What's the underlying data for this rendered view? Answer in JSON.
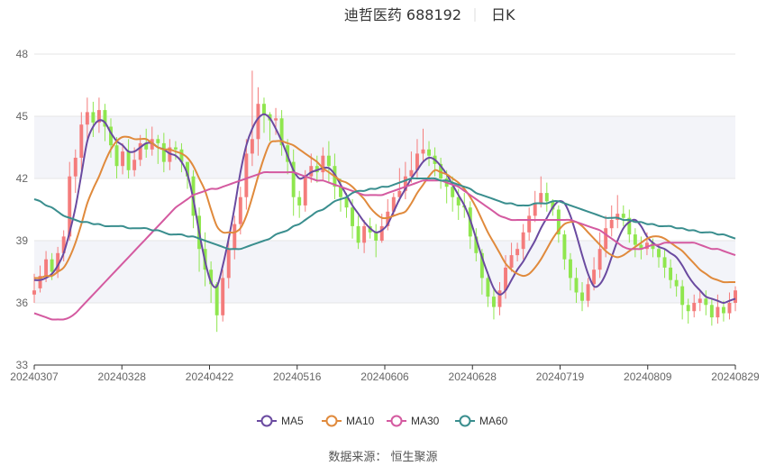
{
  "header": {
    "title": "迪哲医药 688192",
    "period": "日K"
  },
  "source": "数据来源： 恒生聚源",
  "chart_data": {
    "type": "candlestick",
    "ylim": [
      33,
      48
    ],
    "yticks": [
      33,
      36,
      39,
      42,
      45,
      48
    ],
    "xticks": [
      "20240307",
      "20240328",
      "20240422",
      "20240516",
      "20240606",
      "20240628",
      "20240719",
      "20240809",
      "20240829"
    ],
    "num_days": 120,
    "colors": {
      "up": "#f47c7c",
      "down": "#8fe64e",
      "MA5": "#6a4aa0",
      "MA10": "#e08a3c",
      "MA30": "#d45aa0",
      "MA60": "#3a8e8e"
    },
    "candles": [
      [
        36.4,
        36.6,
        36.0,
        37.4
      ],
      [
        36.7,
        37.3,
        36.5,
        37.8
      ],
      [
        37.3,
        38.1,
        37.0,
        38.5
      ],
      [
        38.1,
        37.5,
        37.1,
        38.4
      ],
      [
        37.5,
        38.4,
        37.2,
        38.7
      ],
      [
        38.4,
        39.2,
        38.0,
        39.5
      ],
      [
        39.2,
        42.1,
        39.0,
        42.8
      ],
      [
        42.1,
        43.0,
        41.3,
        43.4
      ],
      [
        43.0,
        44.6,
        42.4,
        45.2
      ],
      [
        44.6,
        45.2,
        43.9,
        45.9
      ],
      [
        45.2,
        44.7,
        44.0,
        45.7
      ],
      [
        44.7,
        45.3,
        44.2,
        45.9
      ],
      [
        45.3,
        44.5,
        43.8,
        45.6
      ],
      [
        44.5,
        43.6,
        43.0,
        44.9
      ],
      [
        43.6,
        42.6,
        42.0,
        44.0
      ],
      [
        42.6,
        43.3,
        42.2,
        43.7
      ],
      [
        43.3,
        42.4,
        42.0,
        43.9
      ],
      [
        42.4,
        42.9,
        42.1,
        43.5
      ],
      [
        42.9,
        43.7,
        42.6,
        44.1
      ],
      [
        43.7,
        43.4,
        43.0,
        44.4
      ],
      [
        43.4,
        43.9,
        43.1,
        44.5
      ],
      [
        43.9,
        43.7,
        42.7,
        44.1
      ],
      [
        43.7,
        42.8,
        42.3,
        44.2
      ],
      [
        42.8,
        43.5,
        42.4,
        43.9
      ],
      [
        43.5,
        43.4,
        42.9,
        43.8
      ],
      [
        43.4,
        42.8,
        42.3,
        43.7
      ],
      [
        42.8,
        42.1,
        41.5,
        42.6
      ],
      [
        42.1,
        40.2,
        39.6,
        42.4
      ],
      [
        40.2,
        38.6,
        37.5,
        40.6
      ],
      [
        38.6,
        37.6,
        36.8,
        39.4
      ],
      [
        37.6,
        36.9,
        36.0,
        38.0
      ],
      [
        36.9,
        35.4,
        34.6,
        37.0
      ],
      [
        35.4,
        37.2,
        35.1,
        37.6
      ],
      [
        37.2,
        38.6,
        36.7,
        39.0
      ],
      [
        38.6,
        39.8,
        38.1,
        40.2
      ],
      [
        39.8,
        41.1,
        39.3,
        41.6
      ],
      [
        41.1,
        43.2,
        40.5,
        43.9
      ],
      [
        43.2,
        43.9,
        42.6,
        47.2
      ],
      [
        43.9,
        45.6,
        43.1,
        46.4
      ],
      [
        45.6,
        45.1,
        44.2,
        45.9
      ],
      [
        45.1,
        44.8,
        43.8,
        45.2
      ],
      [
        44.8,
        44.9,
        44.1,
        45.4
      ],
      [
        44.9,
        43.6,
        43.1,
        45.3
      ],
      [
        43.6,
        42.8,
        42.2,
        43.9
      ],
      [
        42.8,
        41.1,
        40.2,
        43.4
      ],
      [
        41.1,
        40.7,
        40.1,
        41.4
      ],
      [
        40.7,
        42.1,
        40.4,
        42.4
      ],
      [
        42.1,
        42.6,
        41.8,
        43.2
      ],
      [
        42.6,
        42.3,
        41.8,
        43.1
      ],
      [
        42.3,
        43.1,
        41.9,
        43.5
      ],
      [
        43.1,
        42.6,
        41.8,
        43.8
      ],
      [
        42.6,
        41.6,
        41.0,
        43.2
      ],
      [
        41.6,
        41.1,
        40.4,
        42.0
      ],
      [
        41.1,
        40.6,
        40.1,
        41.3
      ],
      [
        40.6,
        39.7,
        39.1,
        41.0
      ],
      [
        39.7,
        38.9,
        38.6,
        40.2
      ],
      [
        38.9,
        39.7,
        38.4,
        40.0
      ],
      [
        39.7,
        39.4,
        39.1,
        40.1
      ],
      [
        39.4,
        39.0,
        38.2,
        39.8
      ],
      [
        39.0,
        39.7,
        38.9,
        40.3
      ],
      [
        39.7,
        40.4,
        39.5,
        41.0
      ],
      [
        40.4,
        41.1,
        40.2,
        41.3
      ],
      [
        41.1,
        41.4,
        40.9,
        42.5
      ],
      [
        41.4,
        42.1,
        41.0,
        42.8
      ],
      [
        42.1,
        42.4,
        41.8,
        43.3
      ],
      [
        42.4,
        43.2,
        42.0,
        43.9
      ],
      [
        43.2,
        43.4,
        42.8,
        44.4
      ],
      [
        43.4,
        43.1,
        42.6,
        43.8
      ],
      [
        43.1,
        42.7,
        42.1,
        43.5
      ],
      [
        42.7,
        42.0,
        41.5,
        43.0
      ],
      [
        42.0,
        41.6,
        40.8,
        42.4
      ],
      [
        41.6,
        41.1,
        40.4,
        42.1
      ],
      [
        41.1,
        40.7,
        40.0,
        41.5
      ],
      [
        40.7,
        40.6,
        40.1,
        41.3
      ],
      [
        40.6,
        39.2,
        38.6,
        40.9
      ],
      [
        39.2,
        38.4,
        38.0,
        39.6
      ],
      [
        38.4,
        37.2,
        36.4,
        38.6
      ],
      [
        37.2,
        36.3,
        35.8,
        37.5
      ],
      [
        36.3,
        35.8,
        35.2,
        36.7
      ],
      [
        35.8,
        36.6,
        35.4,
        37.0
      ],
      [
        36.6,
        37.7,
        36.2,
        38.3
      ],
      [
        37.7,
        38.3,
        37.5,
        38.9
      ],
      [
        38.3,
        38.6,
        38.0,
        38.9
      ],
      [
        38.6,
        39.4,
        38.1,
        39.8
      ],
      [
        39.4,
        40.2,
        39.0,
        40.6
      ],
      [
        40.2,
        40.8,
        39.9,
        41.4
      ],
      [
        40.8,
        41.3,
        40.6,
        42.1
      ],
      [
        41.3,
        40.9,
        40.4,
        41.8
      ],
      [
        40.9,
        40.5,
        40.2,
        41.0
      ],
      [
        40.5,
        39.3,
        38.9,
        40.7
      ],
      [
        39.3,
        38.1,
        37.6,
        39.5
      ],
      [
        38.1,
        37.2,
        36.6,
        38.4
      ],
      [
        37.2,
        36.5,
        36.0,
        37.7
      ],
      [
        36.5,
        36.1,
        35.6,
        37.0
      ],
      [
        36.1,
        36.9,
        35.8,
        37.2
      ],
      [
        36.9,
        37.6,
        36.6,
        38.2
      ],
      [
        37.6,
        38.6,
        37.2,
        39.4
      ],
      [
        38.6,
        39.6,
        38.2,
        40.2
      ],
      [
        39.6,
        40.0,
        39.2,
        40.7
      ],
      [
        40.0,
        40.3,
        39.6,
        41.2
      ],
      [
        40.3,
        40.1,
        39.7,
        40.7
      ],
      [
        40.1,
        39.3,
        38.9,
        40.5
      ],
      [
        39.3,
        38.8,
        38.2,
        39.6
      ],
      [
        38.8,
        38.6,
        38.1,
        39.2
      ],
      [
        38.6,
        38.9,
        38.3,
        39.4
      ],
      [
        38.9,
        38.6,
        38.2,
        39.1
      ],
      [
        38.6,
        38.2,
        37.7,
        38.8
      ],
      [
        38.2,
        37.7,
        37.2,
        38.6
      ],
      [
        37.7,
        37.1,
        36.7,
        38.1
      ],
      [
        37.1,
        36.8,
        36.3,
        37.4
      ],
      [
        36.8,
        35.9,
        35.2,
        37.1
      ],
      [
        35.9,
        35.6,
        35.0,
        36.2
      ],
      [
        35.6,
        36.0,
        35.3,
        36.4
      ],
      [
        36.0,
        36.2,
        35.6,
        36.6
      ],
      [
        36.2,
        35.9,
        35.4,
        36.6
      ],
      [
        35.9,
        35.3,
        34.9,
        36.2
      ],
      [
        35.3,
        35.8,
        35.0,
        36.4
      ],
      [
        35.8,
        35.5,
        35.1,
        36.1
      ],
      [
        35.5,
        36.0,
        35.2,
        36.5
      ],
      [
        36.0,
        36.6,
        35.6,
        36.8
      ]
    ],
    "series": [
      {
        "name": "MA5",
        "values": [
          37.1,
          37.1,
          37.2,
          37.4,
          37.8,
          38.4,
          39.4,
          40.6,
          42.2,
          43.8,
          44.5,
          44.8,
          44.7,
          44.2,
          43.8,
          43.6,
          43.3,
          43.3,
          43.5,
          43.7,
          43.7,
          43.5,
          43.4,
          43.2,
          43.1,
          42.8,
          42.2,
          41.0,
          39.4,
          38.0,
          37.0,
          36.8,
          37.8,
          39.1,
          40.6,
          42.3,
          43.6,
          44.4,
          44.9,
          45.1,
          44.9,
          44.4,
          43.8,
          43.1,
          42.4,
          42.0,
          42.1,
          42.3,
          42.4,
          42.5,
          42.5,
          42.2,
          41.7,
          41.2,
          40.7,
          40.3,
          39.9,
          39.6,
          39.4,
          39.5,
          39.8,
          40.4,
          41.0,
          41.5,
          42.0,
          42.4,
          42.8,
          43.0,
          42.9,
          42.6,
          42.2,
          41.7,
          41.2,
          40.7,
          40.0,
          39.1,
          38.2,
          37.4,
          36.7,
          36.4,
          36.6,
          37.1,
          37.6,
          38.0,
          38.5,
          39.0,
          39.6,
          40.1,
          40.6,
          40.9,
          40.8,
          40.2,
          39.3,
          38.3,
          37.4,
          36.8,
          36.9,
          37.4,
          38.2,
          39.0,
          39.6,
          39.9,
          40.0,
          39.7,
          39.2,
          38.9,
          38.7,
          38.6,
          38.4,
          38.2,
          37.8,
          37.3,
          36.9,
          36.6,
          36.3,
          36.2,
          36.1,
          36.0,
          36.1,
          36.2
        ]
      },
      {
        "name": "MA10",
        "values": [
          37.2,
          37.2,
          37.3,
          37.3,
          37.5,
          37.7,
          38.2,
          38.9,
          39.8,
          40.8,
          41.5,
          42.1,
          42.8,
          43.4,
          43.8,
          44.0,
          44.0,
          43.9,
          43.9,
          43.9,
          43.7,
          43.5,
          43.4,
          43.4,
          43.3,
          43.2,
          43.0,
          42.6,
          42.0,
          41.4,
          40.5,
          39.7,
          39.4,
          39.4,
          39.4,
          39.6,
          40.2,
          41.1,
          42.1,
          43.0,
          43.7,
          43.8,
          43.8,
          43.7,
          43.6,
          43.4,
          43.2,
          43.0,
          42.8,
          42.5,
          42.3,
          42.1,
          41.9,
          41.8,
          41.6,
          41.3,
          41.0,
          40.6,
          40.3,
          40.1,
          40.1,
          40.2,
          40.3,
          40.4,
          40.8,
          41.3,
          41.7,
          42.1,
          42.4,
          42.3,
          42.2,
          42.0,
          41.8,
          41.5,
          41.1,
          40.6,
          40.0,
          39.4,
          38.9,
          38.4,
          37.9,
          37.6,
          37.4,
          37.3,
          37.4,
          37.7,
          38.1,
          38.6,
          39.1,
          39.5,
          39.8,
          39.9,
          39.9,
          39.7,
          39.4,
          39.1,
          38.8,
          38.5,
          38.3,
          38.2,
          38.3,
          38.5,
          38.7,
          38.9,
          39.1,
          39.2,
          39.2,
          39.1,
          38.9,
          38.7,
          38.5,
          38.2,
          37.9,
          37.6,
          37.4,
          37.2,
          37.1,
          37.0,
          37.0,
          37.0
        ]
      },
      {
        "name": "MA30",
        "values": [
          35.5,
          35.4,
          35.3,
          35.2,
          35.2,
          35.2,
          35.3,
          35.5,
          35.8,
          36.1,
          36.4,
          36.7,
          37.0,
          37.3,
          37.6,
          37.9,
          38.2,
          38.5,
          38.8,
          39.1,
          39.4,
          39.7,
          40.0,
          40.3,
          40.6,
          40.8,
          41.0,
          41.2,
          41.3,
          41.4,
          41.5,
          41.5,
          41.6,
          41.7,
          41.8,
          41.9,
          42.0,
          42.1,
          42.2,
          42.3,
          42.3,
          42.3,
          42.3,
          42.3,
          42.3,
          42.2,
          42.1,
          42.0,
          41.9,
          41.9,
          41.8,
          41.7,
          41.6,
          41.5,
          41.4,
          41.3,
          41.2,
          41.2,
          41.2,
          41.2,
          41.3,
          41.4,
          41.5,
          41.6,
          41.7,
          41.8,
          41.9,
          41.9,
          41.9,
          41.9,
          41.8,
          41.7,
          41.6,
          41.4,
          41.2,
          41.0,
          40.8,
          40.6,
          40.4,
          40.2,
          40.1,
          40.0,
          40.0,
          40.0,
          40.0,
          40.0,
          40.0,
          40.0,
          40.0,
          40.0,
          40.0,
          40.0,
          39.9,
          39.8,
          39.7,
          39.6,
          39.5,
          39.3,
          39.1,
          38.9,
          38.7,
          38.6,
          38.6,
          38.6,
          38.7,
          38.8,
          38.8,
          38.9,
          38.9,
          38.9,
          38.9,
          38.9,
          38.9,
          38.8,
          38.7,
          38.6,
          38.6,
          38.5,
          38.4,
          38.3
        ]
      },
      {
        "name": "MA60",
        "values": [
          41.0,
          40.9,
          40.7,
          40.6,
          40.4,
          40.2,
          40.1,
          40.0,
          39.9,
          39.9,
          39.8,
          39.8,
          39.7,
          39.7,
          39.7,
          39.7,
          39.6,
          39.6,
          39.6,
          39.6,
          39.5,
          39.5,
          39.4,
          39.3,
          39.3,
          39.3,
          39.2,
          39.2,
          39.1,
          39.0,
          38.9,
          38.8,
          38.7,
          38.6,
          38.6,
          38.6,
          38.7,
          38.8,
          38.9,
          39.0,
          39.1,
          39.3,
          39.4,
          39.5,
          39.7,
          39.8,
          40.0,
          40.2,
          40.4,
          40.5,
          40.7,
          40.9,
          41.0,
          41.1,
          41.3,
          41.4,
          41.4,
          41.5,
          41.5,
          41.6,
          41.6,
          41.7,
          41.8,
          41.9,
          42.0,
          42.0,
          42.0,
          42.0,
          42.0,
          41.9,
          41.9,
          41.8,
          41.7,
          41.6,
          41.5,
          41.3,
          41.2,
          41.1,
          41.0,
          40.9,
          40.8,
          40.8,
          40.7,
          40.7,
          40.7,
          40.8,
          40.8,
          40.8,
          40.9,
          40.9,
          40.8,
          40.7,
          40.6,
          40.5,
          40.4,
          40.3,
          40.2,
          40.1,
          40.1,
          40.1,
          40.0,
          40.0,
          39.9,
          39.9,
          39.8,
          39.8,
          39.7,
          39.7,
          39.7,
          39.6,
          39.6,
          39.5,
          39.5,
          39.4,
          39.4,
          39.4,
          39.3,
          39.3,
          39.2,
          39.1
        ]
      }
    ]
  }
}
